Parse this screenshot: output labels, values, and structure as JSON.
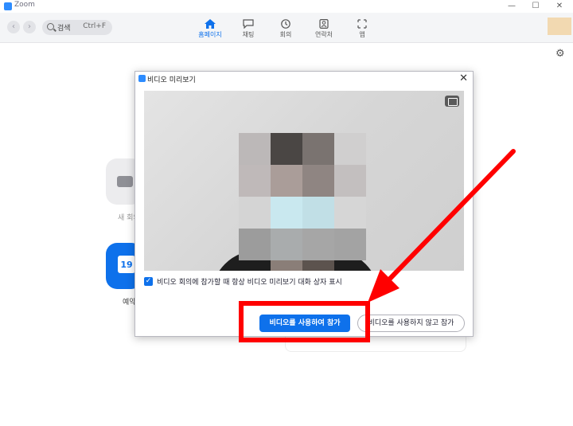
{
  "window": {
    "title": "Zoom",
    "controls": {
      "minimize": "—",
      "maximize": "☐",
      "close": "✕"
    }
  },
  "toolbar": {
    "back": "‹",
    "forward": "›",
    "search": {
      "label": "검색",
      "shortcut": "Ctrl+F"
    },
    "tabs": [
      {
        "label": "홈페이지",
        "icon": "home-icon",
        "active": true
      },
      {
        "label": "채팅",
        "icon": "chat-icon",
        "active": false
      },
      {
        "label": "회의",
        "icon": "clock-icon",
        "active": false
      },
      {
        "label": "연락처",
        "icon": "contacts-icon",
        "active": false
      },
      {
        "label": "앱",
        "icon": "apps-icon",
        "active": false
      }
    ],
    "settings_icon": "⚙"
  },
  "home": {
    "new_meeting_label": "새 회의",
    "schedule_label": "예약",
    "calendar_day": "19"
  },
  "dialog": {
    "title": "비디오 미리보기",
    "close": "✕",
    "checkbox": {
      "checked": true,
      "mark": "✓",
      "label": "비디오 회의에 참가할 때 항상 비디오 미리보기 대화 상자 표시"
    },
    "join_with_video": "비디오를 사용하여 참가",
    "join_without_video": "비디오를 사용하지 않고 참가"
  },
  "colors": {
    "accent": "#0e71eb",
    "annotation": "#ff0000"
  }
}
